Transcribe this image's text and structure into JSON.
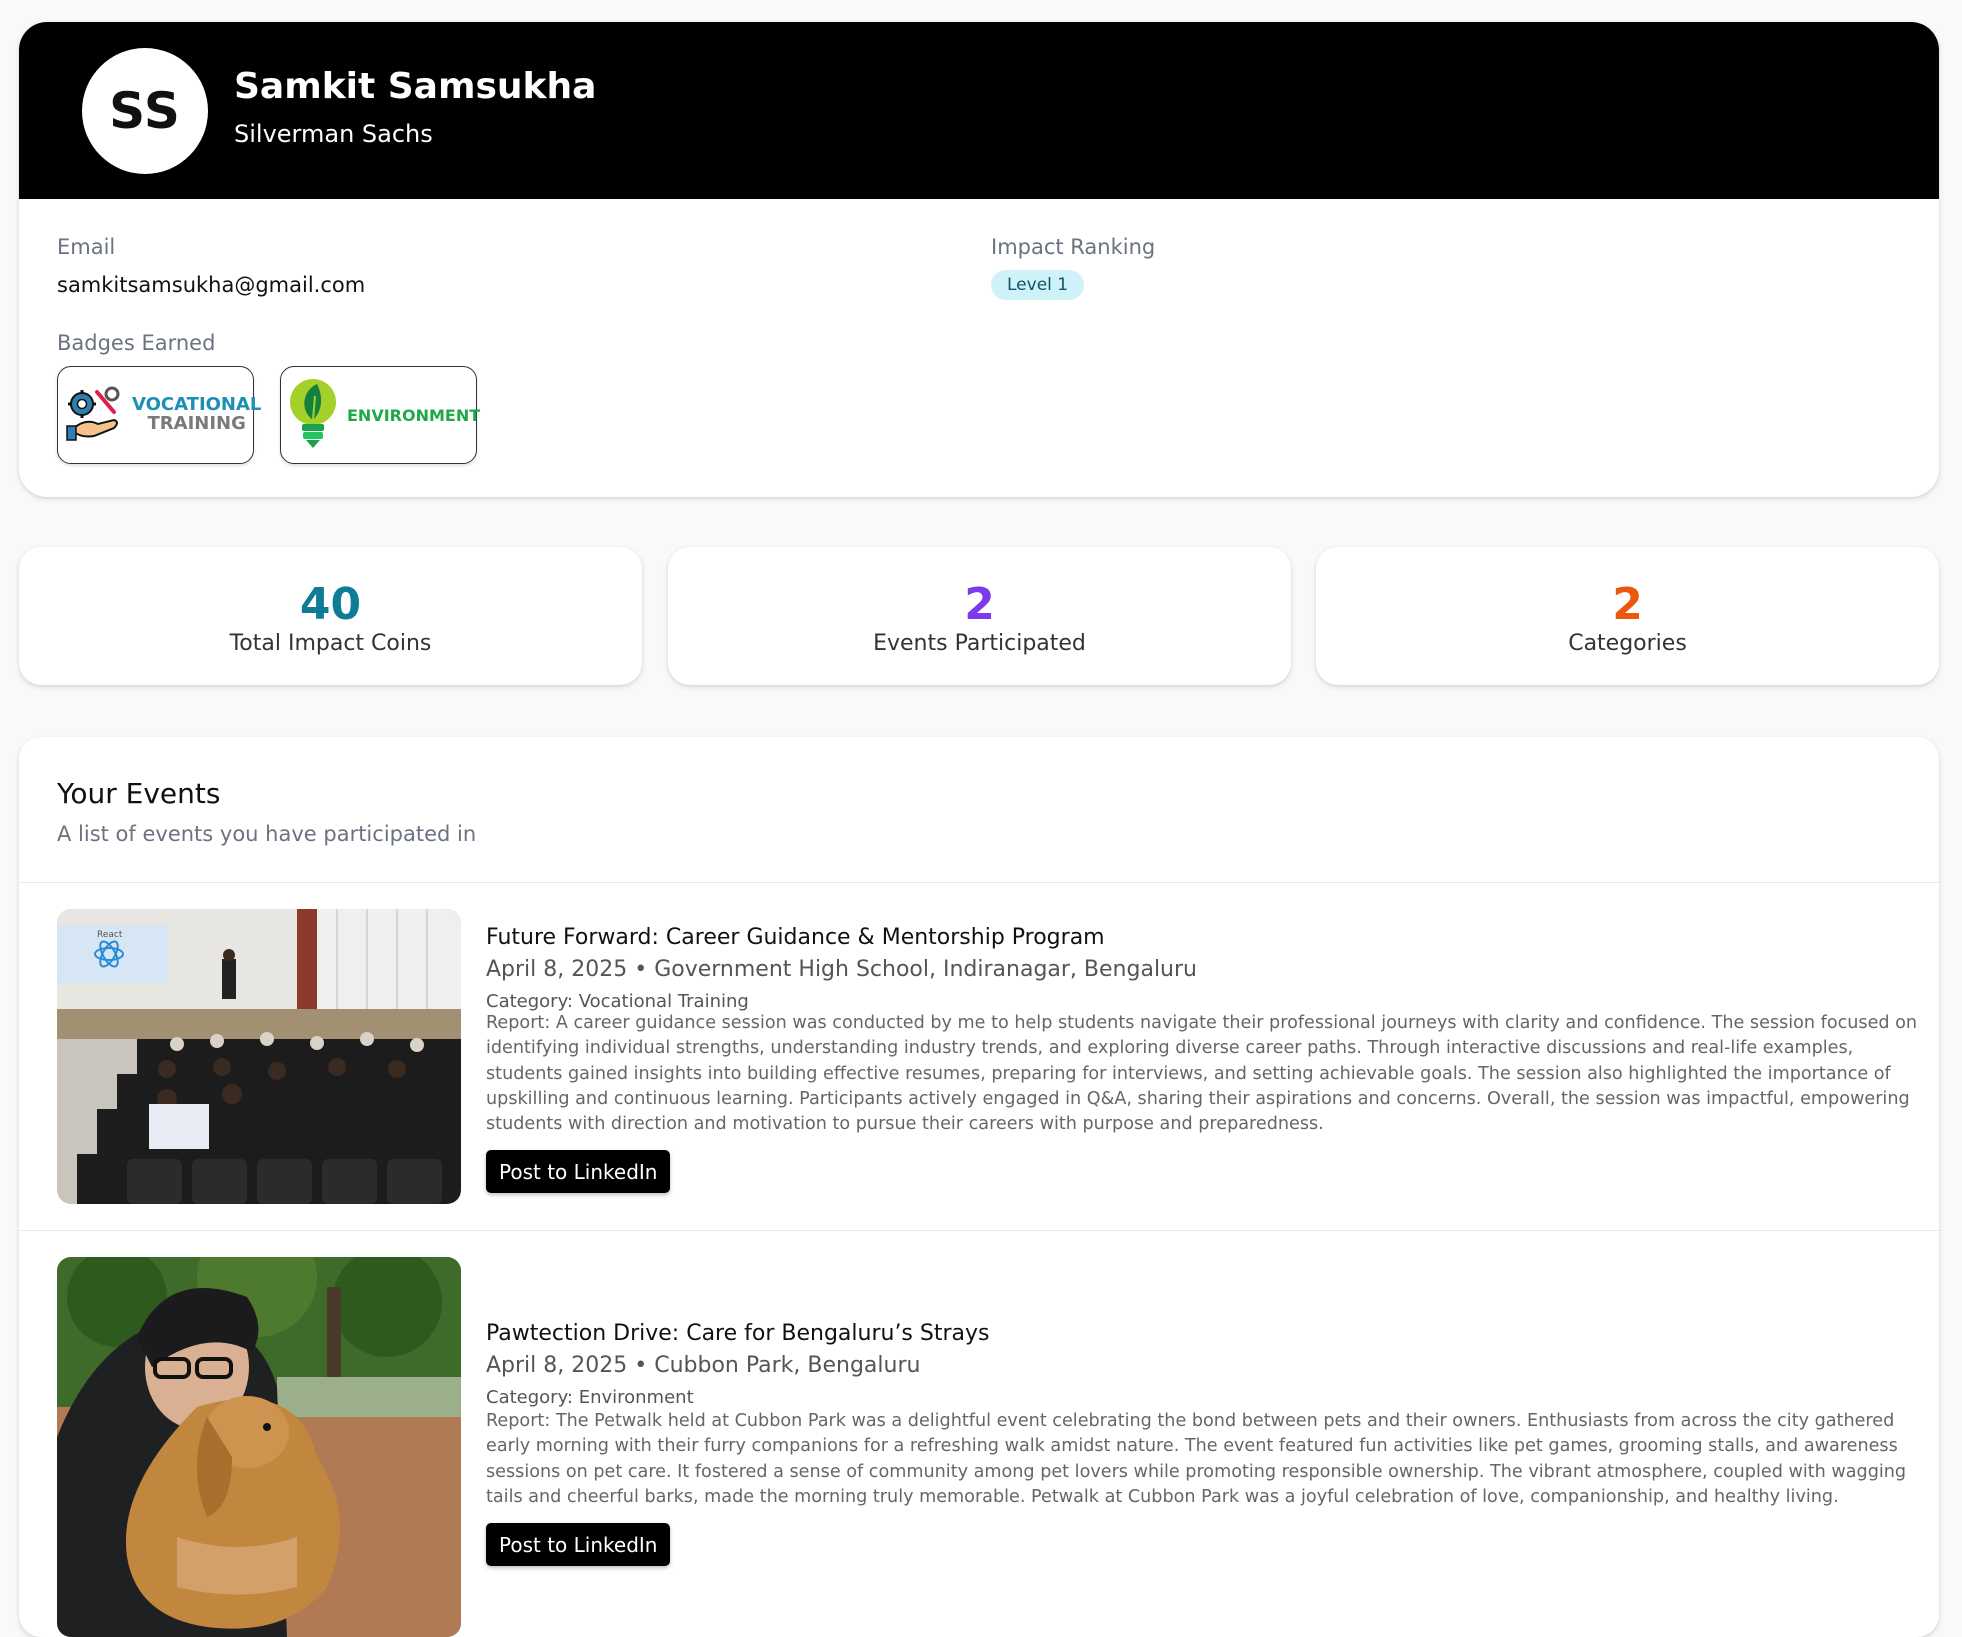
{
  "profile": {
    "initials": "SS",
    "name": "Samkit Samsukha",
    "company": "Silverman Sachs",
    "email_label": "Email",
    "email": "samkitsamsukha@gmail.com",
    "ranking_label": "Impact Ranking",
    "ranking": "Level 1",
    "badges_label": "Badges Earned",
    "badges": [
      {
        "line1": "VOCATIONAL",
        "line2": "TRAINING",
        "icon": "gear-wrench-hand-icon"
      },
      {
        "line1": "ENVIRONMENT",
        "icon": "leaf-bulb-icon"
      }
    ]
  },
  "stats": [
    {
      "value": "40",
      "label": "Total Impact Coins",
      "color": "#0e7c96"
    },
    {
      "value": "2",
      "label": "Events Participated",
      "color": "#7c3aed"
    },
    {
      "value": "2",
      "label": "Categories",
      "color": "#ea580c"
    }
  ],
  "events": {
    "title": "Your Events",
    "subtitle": "A list of events you have participated in",
    "items": [
      {
        "title": "Future Forward: Career Guidance & Mentorship Program",
        "meta": "April 8, 2025 • Government High School, Indiranagar, Bengaluru",
        "category": "Category: Vocational Training",
        "report": "Report: A career guidance session was conducted by me to help students navigate their professional journeys with clarity and confidence. The session focused on identifying individual strengths, understanding industry trends, and exploring diverse career paths. Through interactive discussions and real-life examples, students gained insights into building effective resumes, preparing for interviews, and setting achievable goals. The session also highlighted the importance of upskilling and continuous learning. Participants actively engaged in Q&A, sharing their aspirations and concerns. Overall, the session was impactful, empowering students with direction and motivation to pursue their careers with purpose and preparedness.",
        "button": "Post to LinkedIn",
        "slide_text": "React"
      },
      {
        "title": "Pawtection Drive: Care for Bengaluru’s Strays",
        "meta": "April 8, 2025 • Cubbon Park, Bengaluru",
        "category": "Category: Environment",
        "report": "Report: The Petwalk held at Cubbon Park was a delightful event celebrating the bond between pets and their owners. Enthusiasts from across the city gathered early morning with their furry companions for a refreshing walk amidst nature. The event featured fun activities like pet games, grooming stalls, and awareness sessions on pet care. It fostered a sense of community among pet lovers while promoting responsible ownership. The vibrant atmosphere, coupled with wagging tails and cheerful barks, made the morning truly memorable. Petwalk at Cubbon Park was a joyful celebration of love, companionship, and healthy living.",
        "button": "Post to LinkedIn"
      }
    ]
  }
}
